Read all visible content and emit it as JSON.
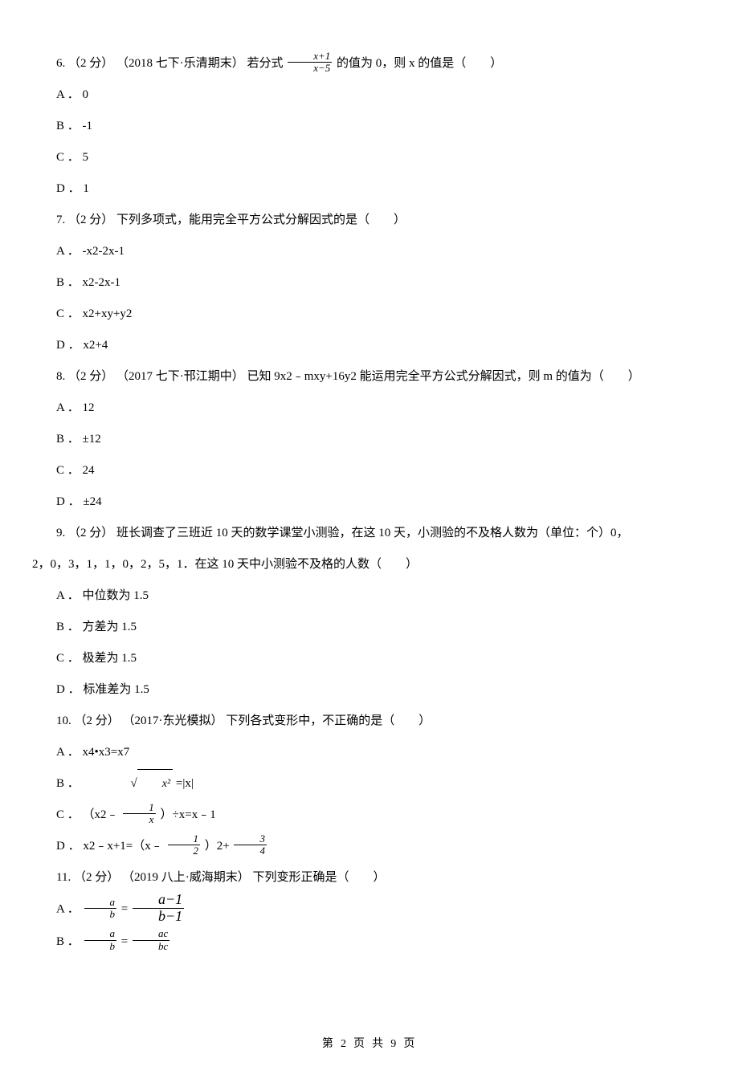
{
  "q6": {
    "stem_before": "6. （2 分） （2018 七下·乐清期末） 若分式 ",
    "frac_num": "x+1",
    "frac_den": "x−5",
    "stem_after": " 的值为 0，则 x 的值是（　　）",
    "A": "A ．  0",
    "B": "B ． -1",
    "C": "C ．  5",
    "D": "D ．  1"
  },
  "q7": {
    "stem": "7. （2 分）  下列多项式，能用完全平方公式分解因式的是（　　）",
    "A": "A ． -x2-2x-1",
    "B": "B ．  x2-2x-1",
    "C": "C ．  x2+xy+y2",
    "D": "D ．  x2+4"
  },
  "q8": {
    "stem": "8. （2 分） （2017 七下·邗江期中） 已知 9x2﹣mxy+16y2 能运用完全平方公式分解因式，则 m 的值为（　　）",
    "A": "A ．  12",
    "B": "B ． ±12",
    "C": "C ．  24",
    "D": "D ． ±24"
  },
  "q9": {
    "stem_line1": "9. （2 分）  班长调查了三班近 10 天的数学课堂小测验，在这 10 天，小测验的不及格人数为（单位：个）0，",
    "stem_line2": "2，0，3，1，1，0，2，5，1．在这 10 天中小测验不及格的人数（　　）",
    "A": "A ． 中位数为 1.5",
    "B": "B ． 方差为 1.5",
    "C": "C ． 极差为 1.5",
    "D": "D ． 标准差为 1.5"
  },
  "q10": {
    "stem": "10. （2 分） （2017·东光模拟） 下列各式变形中，不正确的是（　　）",
    "A": "A ．  x4•x3=x7",
    "B_before": "B ．  ",
    "B_sqrt": "x²",
    "B_after": " =|x|",
    "C_before": "C ． （x2﹣ ",
    "C_frac_num": "1",
    "C_frac_den": "x",
    "C_after": " ）÷x=x﹣1",
    "D_before": "D ．  x2﹣x+1=（x﹣ ",
    "D_frac1_num": "1",
    "D_frac1_den": "2",
    "D_mid": " ）2+ ",
    "D_frac2_num": "3",
    "D_frac2_den": "4"
  },
  "q11": {
    "stem": "11. （2 分） （2019 八上·威海期末） 下列变形正确是（　　）",
    "A_before": "A ．  ",
    "A_frac1_num": "a",
    "A_frac1_den": "b",
    "A_eq": " = ",
    "A_frac2_num": "a−1",
    "A_frac2_den": "b−1",
    "B_before": "B ．  ",
    "B_frac1_num": "a",
    "B_frac1_den": "b",
    "B_eq": " = ",
    "B_frac2_num": "ac",
    "B_frac2_den": "bc"
  },
  "footer": "第 2 页 共 9 页"
}
